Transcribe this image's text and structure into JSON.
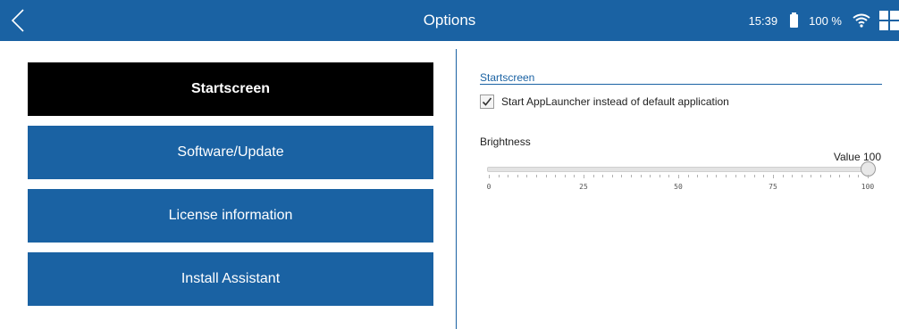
{
  "header": {
    "title": "Options",
    "time": "15:39",
    "battery_pct": "100 %"
  },
  "menu": {
    "items": [
      {
        "label": "Startscreen",
        "active": true
      },
      {
        "label": "Software/Update",
        "active": false
      },
      {
        "label": "License information",
        "active": false
      },
      {
        "label": "Install Assistant",
        "active": false
      }
    ]
  },
  "panel": {
    "section_title": "Startscreen",
    "checkbox_label": "Start AppLauncher instead of default application",
    "checkbox_checked": true,
    "brightness_label": "Brightness",
    "value_text": "Value  100",
    "slider": {
      "min": 0,
      "max": 100,
      "value": 100,
      "tick_labels": [
        "0",
        "25",
        "50",
        "75",
        "100"
      ]
    }
  },
  "colors": {
    "accent": "#1a62a3",
    "active_menu": "#000000"
  }
}
